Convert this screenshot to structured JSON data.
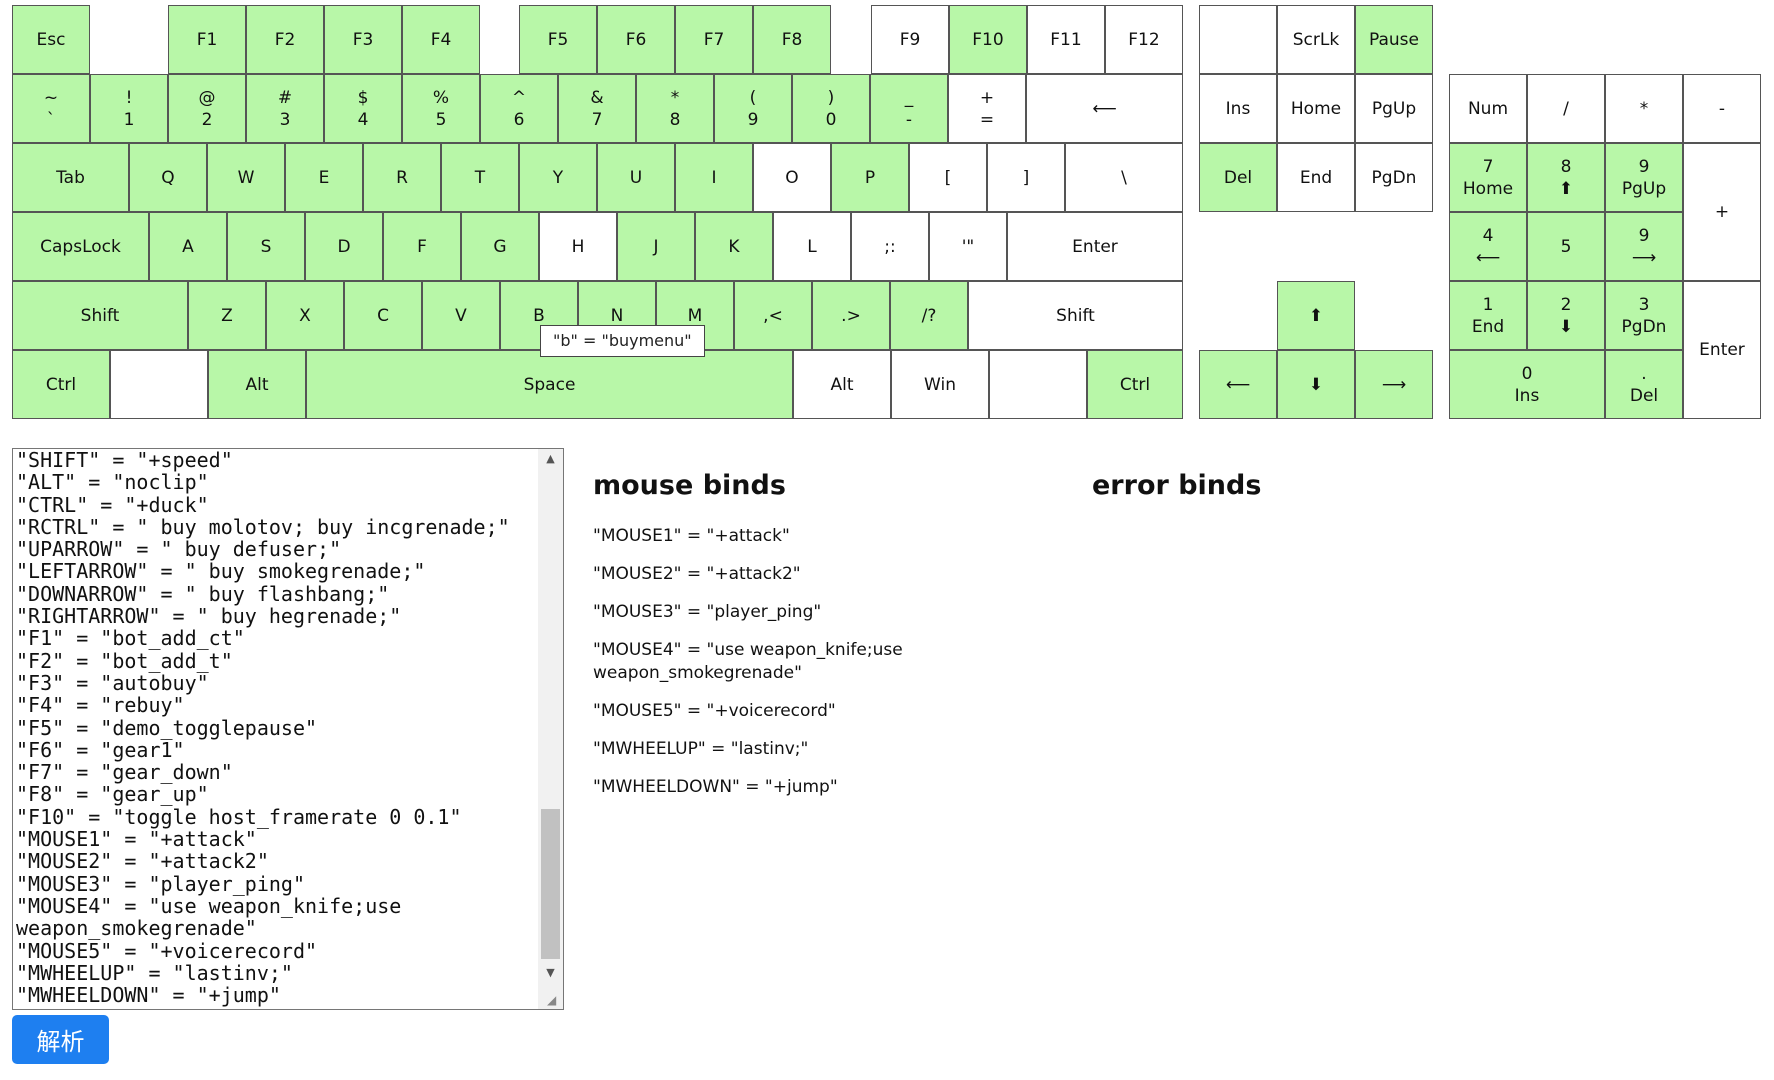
{
  "keyboard": {
    "keys": [
      {
        "id": "esc",
        "label": "Esc",
        "bound": true
      },
      {
        "id": "f1",
        "label": "F1",
        "bound": true
      },
      {
        "id": "f2",
        "label": "F2",
        "bound": true
      },
      {
        "id": "f3",
        "label": "F3",
        "bound": true
      },
      {
        "id": "f4",
        "label": "F4",
        "bound": true
      },
      {
        "id": "f5",
        "label": "F5",
        "bound": true
      },
      {
        "id": "f6",
        "label": "F6",
        "bound": true
      },
      {
        "id": "f7",
        "label": "F7",
        "bound": true
      },
      {
        "id": "f8",
        "label": "F8",
        "bound": true
      },
      {
        "id": "f9",
        "label": "F9",
        "bound": false
      },
      {
        "id": "f10",
        "label": "F10",
        "bound": true
      },
      {
        "id": "f11",
        "label": "F11",
        "bound": false
      },
      {
        "id": "f12",
        "label": "F12",
        "bound": false
      },
      {
        "id": "prtsc",
        "label": "",
        "bound": false
      },
      {
        "id": "scrlk",
        "label": "ScrLk",
        "bound": false
      },
      {
        "id": "pause",
        "label": "Pause",
        "bound": true
      },
      {
        "id": "grave",
        "label": "~",
        "label2": "`",
        "bound": true
      },
      {
        "id": "1",
        "label": "!",
        "label2": "1",
        "bound": true
      },
      {
        "id": "2",
        "label": "@",
        "label2": "2",
        "bound": true
      },
      {
        "id": "3",
        "label": "#",
        "label2": "3",
        "bound": true
      },
      {
        "id": "4",
        "label": "$",
        "label2": "4",
        "bound": true
      },
      {
        "id": "5",
        "label": "%",
        "label2": "5",
        "bound": true
      },
      {
        "id": "6",
        "label": "^",
        "label2": "6",
        "bound": true
      },
      {
        "id": "7",
        "label": "&",
        "label2": "7",
        "bound": true
      },
      {
        "id": "8",
        "label": "*",
        "label2": "8",
        "bound": true
      },
      {
        "id": "9",
        "label": "(",
        "label2": "9",
        "bound": true
      },
      {
        "id": "0",
        "label": ")",
        "label2": "0",
        "bound": true
      },
      {
        "id": "minus",
        "label": "_",
        "label2": "-",
        "bound": true
      },
      {
        "id": "equals",
        "label": "+",
        "label2": "=",
        "bound": false
      },
      {
        "id": "backspace",
        "label": "⟵",
        "bound": false
      },
      {
        "id": "ins",
        "label": "Ins",
        "bound": false
      },
      {
        "id": "home",
        "label": "Home",
        "bound": false
      },
      {
        "id": "pgup",
        "label": "PgUp",
        "bound": false
      },
      {
        "id": "numlock",
        "label": "Num",
        "bound": false
      },
      {
        "id": "kp_slash",
        "label": "/",
        "bound": false
      },
      {
        "id": "kp_multiply",
        "label": "*",
        "bound": false
      },
      {
        "id": "kp_minus",
        "label": "-",
        "bound": false
      },
      {
        "id": "tab",
        "label": "Tab",
        "bound": true
      },
      {
        "id": "q",
        "label": "Q",
        "bound": true
      },
      {
        "id": "w",
        "label": "W",
        "bound": true
      },
      {
        "id": "e",
        "label": "E",
        "bound": true
      },
      {
        "id": "r",
        "label": "R",
        "bound": true
      },
      {
        "id": "t",
        "label": "T",
        "bound": true
      },
      {
        "id": "y",
        "label": "Y",
        "bound": true
      },
      {
        "id": "u",
        "label": "U",
        "bound": true
      },
      {
        "id": "i",
        "label": "I",
        "bound": true
      },
      {
        "id": "o",
        "label": "O",
        "bound": false
      },
      {
        "id": "p",
        "label": "P",
        "bound": true
      },
      {
        "id": "lbracket",
        "label": "[",
        "bound": false
      },
      {
        "id": "rbracket",
        "label": "]",
        "bound": false
      },
      {
        "id": "backslash",
        "label": "\\",
        "bound": false
      },
      {
        "id": "del",
        "label": "Del",
        "bound": true
      },
      {
        "id": "end",
        "label": "End",
        "bound": false
      },
      {
        "id": "pgdn",
        "label": "PgDn",
        "bound": false
      },
      {
        "id": "kp_7",
        "label": "7",
        "label2": "Home",
        "bound": true
      },
      {
        "id": "kp_8",
        "label": "8",
        "label2": "⬆",
        "bound": true
      },
      {
        "id": "kp_9",
        "label": "9",
        "label2": "PgUp",
        "bound": true
      },
      {
        "id": "kp_plus",
        "label": "+",
        "bound": false
      },
      {
        "id": "capslock",
        "label": "CapsLock",
        "bound": true
      },
      {
        "id": "a",
        "label": "A",
        "bound": true
      },
      {
        "id": "s",
        "label": "S",
        "bound": true
      },
      {
        "id": "d",
        "label": "D",
        "bound": true
      },
      {
        "id": "f",
        "label": "F",
        "bound": true
      },
      {
        "id": "g",
        "label": "G",
        "bound": true
      },
      {
        "id": "h",
        "label": "H",
        "bound": false
      },
      {
        "id": "j",
        "label": "J",
        "bound": true
      },
      {
        "id": "k",
        "label": "K",
        "bound": true
      },
      {
        "id": "l",
        "label": "L",
        "bound": false
      },
      {
        "id": "semicolon",
        "label": ";:",
        "bound": false
      },
      {
        "id": "quote",
        "label": "'\"",
        "bound": false
      },
      {
        "id": "enter",
        "label": "Enter",
        "bound": false
      },
      {
        "id": "kp_4",
        "label": "4",
        "label2": "⟵",
        "bound": true
      },
      {
        "id": "kp_5",
        "label": "5",
        "bound": true
      },
      {
        "id": "kp_6",
        "label": "9",
        "label2": "⟶",
        "bound": true
      },
      {
        "id": "lshift",
        "label": "Shift",
        "bound": true
      },
      {
        "id": "z",
        "label": "Z",
        "bound": true
      },
      {
        "id": "x",
        "label": "X",
        "bound": true
      },
      {
        "id": "c",
        "label": "C",
        "bound": true
      },
      {
        "id": "v",
        "label": "V",
        "bound": true
      },
      {
        "id": "b",
        "label": "B",
        "bound": true
      },
      {
        "id": "n",
        "label": "N",
        "bound": true
      },
      {
        "id": "m",
        "label": "M",
        "bound": true
      },
      {
        "id": "comma",
        "label": ",<",
        "bound": true
      },
      {
        "id": "period",
        "label": ".>",
        "bound": true
      },
      {
        "id": "slash",
        "label": "/?",
        "bound": true
      },
      {
        "id": "rshift",
        "label": "Shift",
        "bound": false
      },
      {
        "id": "uparrow",
        "label": "⬆",
        "bound": true
      },
      {
        "id": "kp_1",
        "label": "1",
        "label2": "End",
        "bound": true
      },
      {
        "id": "kp_2",
        "label": "2",
        "label2": "⬇",
        "bound": true
      },
      {
        "id": "kp_3",
        "label": "3",
        "label2": "PgDn",
        "bound": true
      },
      {
        "id": "kp_enter",
        "label": "Enter",
        "bound": false
      },
      {
        "id": "lctrl",
        "label": "Ctrl",
        "bound": true
      },
      {
        "id": "lwin",
        "label": "",
        "bound": false
      },
      {
        "id": "lalt",
        "label": "Alt",
        "bound": true
      },
      {
        "id": "space",
        "label": "Space",
        "bound": true
      },
      {
        "id": "ralt",
        "label": "Alt",
        "bound": false
      },
      {
        "id": "rwin",
        "label": "Win",
        "bound": false
      },
      {
        "id": "menu",
        "label": "",
        "bound": false
      },
      {
        "id": "rctrl",
        "label": "Ctrl",
        "bound": true
      },
      {
        "id": "leftarrow",
        "label": "⟵",
        "bound": true
      },
      {
        "id": "downarrow",
        "label": "⬇",
        "bound": true
      },
      {
        "id": "rightarrow",
        "label": "⟶",
        "bound": true
      },
      {
        "id": "kp_0",
        "label": "0",
        "label2": "Ins",
        "bound": true
      },
      {
        "id": "kp_del",
        "label": ".",
        "label2": "Del",
        "bound": true
      }
    ],
    "tooltip": "\"b\" = \"buymenu\"",
    "bound_color": "#b8f7a8",
    "unbound_color": "#ffffff"
  },
  "editor": {
    "text": "\"SHIFT\" = \"+speed\"\n\"ALT\" = \"noclip\"\n\"CTRL\" = \"+duck\"\n\"RCTRL\" = \" buy molotov; buy incgrenade;\"\n\"UPARROW\" = \" buy defuser;\"\n\"LEFTARROW\" = \" buy smokegrenade;\"\n\"DOWNARROW\" = \" buy flashbang;\"\n\"RIGHTARROW\" = \" buy hegrenade;\"\n\"F1\" = \"bot_add_ct\"\n\"F2\" = \"bot_add_t\"\n\"F3\" = \"autobuy\"\n\"F4\" = \"rebuy\"\n\"F5\" = \"demo_togglepause\"\n\"F6\" = \"gear1\"\n\"F7\" = \"gear_down\"\n\"F8\" = \"gear_up\"\n\"F10\" = \"toggle host_framerate 0 0.1\"\n\"MOUSE1\" = \"+attack\"\n\"MOUSE2\" = \"+attack2\"\n\"MOUSE3\" = \"player_ping\"\n\"MOUSE4\" = \"use weapon_knife;use weapon_smokegrenade\"\n\"MOUSE5\" = \"+voicerecord\"\n\"MWHEELUP\" = \"lastinv;\"\n\"MWHEELDOWN\" = \"+jump\""
  },
  "parse_button": "解析",
  "mouse_binds": {
    "title": "mouse binds",
    "items": [
      "\"MOUSE1\" = \"+attack\"",
      "\"MOUSE2\" = \"+attack2\"",
      "\"MOUSE3\" = \"player_ping\"",
      "\"MOUSE4\" = \"use weapon_knife;use weapon_smokegrenade\"",
      "\"MOUSE5\" = \"+voicerecord\"",
      "\"MWHEELUP\" = \"lastinv;\"",
      "\"MWHEELDOWN\" = \"+jump\""
    ]
  },
  "error_binds": {
    "title": "error binds"
  },
  "accent_color": "#1e7ff0"
}
